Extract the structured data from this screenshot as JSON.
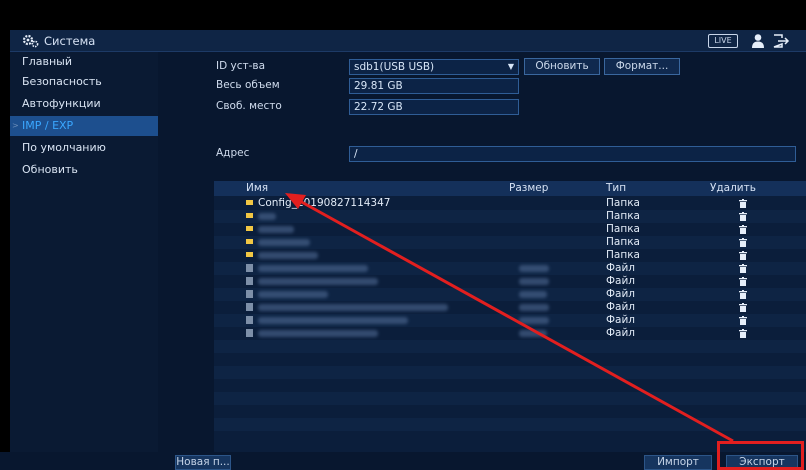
{
  "titlebar": {
    "title": "Система",
    "live_label": "LIVE",
    "icons": [
      "settings-gear-icon",
      "user-icon",
      "exit-icon"
    ]
  },
  "sidebar": {
    "items": [
      {
        "label": "Главный"
      },
      {
        "label": "Безопасность"
      },
      {
        "label": "Автофункции"
      },
      {
        "label": "IMP / EXP",
        "active": true
      },
      {
        "label": "По умолчанию"
      },
      {
        "label": "Обновить"
      }
    ]
  },
  "form": {
    "device_label": "ID уст-ва",
    "device_value": "sdb1(USB USB)",
    "refresh_button": "Обновить",
    "format_button": "Формат...",
    "total_label": "Весь объем",
    "total_value": "29.81 GB",
    "free_label": "Своб. место",
    "free_value": "22.72 GB",
    "address_label": "Адрес",
    "address_value": "/"
  },
  "table": {
    "headers": {
      "name": "Имя",
      "size": "Размер",
      "type": "Тип",
      "delete": "Удалить"
    },
    "rows": [
      {
        "name": "Config_20190827114347",
        "size": "",
        "type": "Папка",
        "kind": "folder"
      },
      {
        "name": "",
        "size": "",
        "type": "Папка",
        "kind": "folder"
      },
      {
        "name": "",
        "size": "",
        "type": "Папка",
        "kind": "folder"
      },
      {
        "name": "",
        "size": "",
        "type": "Папка",
        "kind": "folder"
      },
      {
        "name": "",
        "size": "",
        "type": "Папка",
        "kind": "folder"
      },
      {
        "name": "",
        "size": "",
        "type": "Файл",
        "kind": "file"
      },
      {
        "name": "",
        "size": "",
        "type": "Файл",
        "kind": "file"
      },
      {
        "name": "",
        "size": "",
        "type": "Файл",
        "kind": "file"
      },
      {
        "name": "",
        "size": "",
        "type": "Файл",
        "kind": "file"
      },
      {
        "name": "",
        "size": "",
        "type": "Файл",
        "kind": "file"
      },
      {
        "name": "",
        "size": "",
        "type": "Файл",
        "kind": "file"
      }
    ]
  },
  "bottom": {
    "new_button": "Новая п...",
    "import_button": "Импорт",
    "export_button": "Экспорт"
  },
  "colors": {
    "accent": "#3aa7ff",
    "highlight_red": "#e21f1f",
    "folder_yellow": "#f2c744"
  }
}
